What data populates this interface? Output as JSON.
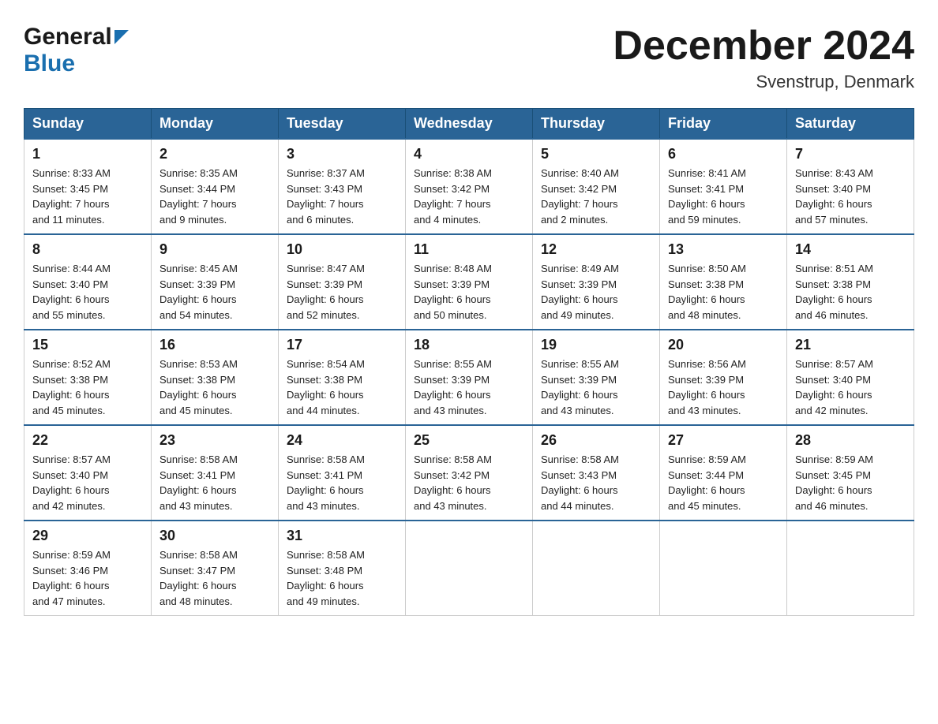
{
  "header": {
    "logo_general": "General",
    "logo_blue": "Blue",
    "month_title": "December 2024",
    "location": "Svenstrup, Denmark"
  },
  "days_of_week": [
    "Sunday",
    "Monday",
    "Tuesday",
    "Wednesday",
    "Thursday",
    "Friday",
    "Saturday"
  ],
  "weeks": [
    [
      {
        "day": "1",
        "sunrise": "Sunrise: 8:33 AM",
        "sunset": "Sunset: 3:45 PM",
        "daylight": "Daylight: 7 hours",
        "daylight2": "and 11 minutes."
      },
      {
        "day": "2",
        "sunrise": "Sunrise: 8:35 AM",
        "sunset": "Sunset: 3:44 PM",
        "daylight": "Daylight: 7 hours",
        "daylight2": "and 9 minutes."
      },
      {
        "day": "3",
        "sunrise": "Sunrise: 8:37 AM",
        "sunset": "Sunset: 3:43 PM",
        "daylight": "Daylight: 7 hours",
        "daylight2": "and 6 minutes."
      },
      {
        "day": "4",
        "sunrise": "Sunrise: 8:38 AM",
        "sunset": "Sunset: 3:42 PM",
        "daylight": "Daylight: 7 hours",
        "daylight2": "and 4 minutes."
      },
      {
        "day": "5",
        "sunrise": "Sunrise: 8:40 AM",
        "sunset": "Sunset: 3:42 PM",
        "daylight": "Daylight: 7 hours",
        "daylight2": "and 2 minutes."
      },
      {
        "day": "6",
        "sunrise": "Sunrise: 8:41 AM",
        "sunset": "Sunset: 3:41 PM",
        "daylight": "Daylight: 6 hours",
        "daylight2": "and 59 minutes."
      },
      {
        "day": "7",
        "sunrise": "Sunrise: 8:43 AM",
        "sunset": "Sunset: 3:40 PM",
        "daylight": "Daylight: 6 hours",
        "daylight2": "and 57 minutes."
      }
    ],
    [
      {
        "day": "8",
        "sunrise": "Sunrise: 8:44 AM",
        "sunset": "Sunset: 3:40 PM",
        "daylight": "Daylight: 6 hours",
        "daylight2": "and 55 minutes."
      },
      {
        "day": "9",
        "sunrise": "Sunrise: 8:45 AM",
        "sunset": "Sunset: 3:39 PM",
        "daylight": "Daylight: 6 hours",
        "daylight2": "and 54 minutes."
      },
      {
        "day": "10",
        "sunrise": "Sunrise: 8:47 AM",
        "sunset": "Sunset: 3:39 PM",
        "daylight": "Daylight: 6 hours",
        "daylight2": "and 52 minutes."
      },
      {
        "day": "11",
        "sunrise": "Sunrise: 8:48 AM",
        "sunset": "Sunset: 3:39 PM",
        "daylight": "Daylight: 6 hours",
        "daylight2": "and 50 minutes."
      },
      {
        "day": "12",
        "sunrise": "Sunrise: 8:49 AM",
        "sunset": "Sunset: 3:39 PM",
        "daylight": "Daylight: 6 hours",
        "daylight2": "and 49 minutes."
      },
      {
        "day": "13",
        "sunrise": "Sunrise: 8:50 AM",
        "sunset": "Sunset: 3:38 PM",
        "daylight": "Daylight: 6 hours",
        "daylight2": "and 48 minutes."
      },
      {
        "day": "14",
        "sunrise": "Sunrise: 8:51 AM",
        "sunset": "Sunset: 3:38 PM",
        "daylight": "Daylight: 6 hours",
        "daylight2": "and 46 minutes."
      }
    ],
    [
      {
        "day": "15",
        "sunrise": "Sunrise: 8:52 AM",
        "sunset": "Sunset: 3:38 PM",
        "daylight": "Daylight: 6 hours",
        "daylight2": "and 45 minutes."
      },
      {
        "day": "16",
        "sunrise": "Sunrise: 8:53 AM",
        "sunset": "Sunset: 3:38 PM",
        "daylight": "Daylight: 6 hours",
        "daylight2": "and 45 minutes."
      },
      {
        "day": "17",
        "sunrise": "Sunrise: 8:54 AM",
        "sunset": "Sunset: 3:38 PM",
        "daylight": "Daylight: 6 hours",
        "daylight2": "and 44 minutes."
      },
      {
        "day": "18",
        "sunrise": "Sunrise: 8:55 AM",
        "sunset": "Sunset: 3:39 PM",
        "daylight": "Daylight: 6 hours",
        "daylight2": "and 43 minutes."
      },
      {
        "day": "19",
        "sunrise": "Sunrise: 8:55 AM",
        "sunset": "Sunset: 3:39 PM",
        "daylight": "Daylight: 6 hours",
        "daylight2": "and 43 minutes."
      },
      {
        "day": "20",
        "sunrise": "Sunrise: 8:56 AM",
        "sunset": "Sunset: 3:39 PM",
        "daylight": "Daylight: 6 hours",
        "daylight2": "and 43 minutes."
      },
      {
        "day": "21",
        "sunrise": "Sunrise: 8:57 AM",
        "sunset": "Sunset: 3:40 PM",
        "daylight": "Daylight: 6 hours",
        "daylight2": "and 42 minutes."
      }
    ],
    [
      {
        "day": "22",
        "sunrise": "Sunrise: 8:57 AM",
        "sunset": "Sunset: 3:40 PM",
        "daylight": "Daylight: 6 hours",
        "daylight2": "and 42 minutes."
      },
      {
        "day": "23",
        "sunrise": "Sunrise: 8:58 AM",
        "sunset": "Sunset: 3:41 PM",
        "daylight": "Daylight: 6 hours",
        "daylight2": "and 43 minutes."
      },
      {
        "day": "24",
        "sunrise": "Sunrise: 8:58 AM",
        "sunset": "Sunset: 3:41 PM",
        "daylight": "Daylight: 6 hours",
        "daylight2": "and 43 minutes."
      },
      {
        "day": "25",
        "sunrise": "Sunrise: 8:58 AM",
        "sunset": "Sunset: 3:42 PM",
        "daylight": "Daylight: 6 hours",
        "daylight2": "and 43 minutes."
      },
      {
        "day": "26",
        "sunrise": "Sunrise: 8:58 AM",
        "sunset": "Sunset: 3:43 PM",
        "daylight": "Daylight: 6 hours",
        "daylight2": "and 44 minutes."
      },
      {
        "day": "27",
        "sunrise": "Sunrise: 8:59 AM",
        "sunset": "Sunset: 3:44 PM",
        "daylight": "Daylight: 6 hours",
        "daylight2": "and 45 minutes."
      },
      {
        "day": "28",
        "sunrise": "Sunrise: 8:59 AM",
        "sunset": "Sunset: 3:45 PM",
        "daylight": "Daylight: 6 hours",
        "daylight2": "and 46 minutes."
      }
    ],
    [
      {
        "day": "29",
        "sunrise": "Sunrise: 8:59 AM",
        "sunset": "Sunset: 3:46 PM",
        "daylight": "Daylight: 6 hours",
        "daylight2": "and 47 minutes."
      },
      {
        "day": "30",
        "sunrise": "Sunrise: 8:58 AM",
        "sunset": "Sunset: 3:47 PM",
        "daylight": "Daylight: 6 hours",
        "daylight2": "and 48 minutes."
      },
      {
        "day": "31",
        "sunrise": "Sunrise: 8:58 AM",
        "sunset": "Sunset: 3:48 PM",
        "daylight": "Daylight: 6 hours",
        "daylight2": "and 49 minutes."
      },
      null,
      null,
      null,
      null
    ]
  ]
}
